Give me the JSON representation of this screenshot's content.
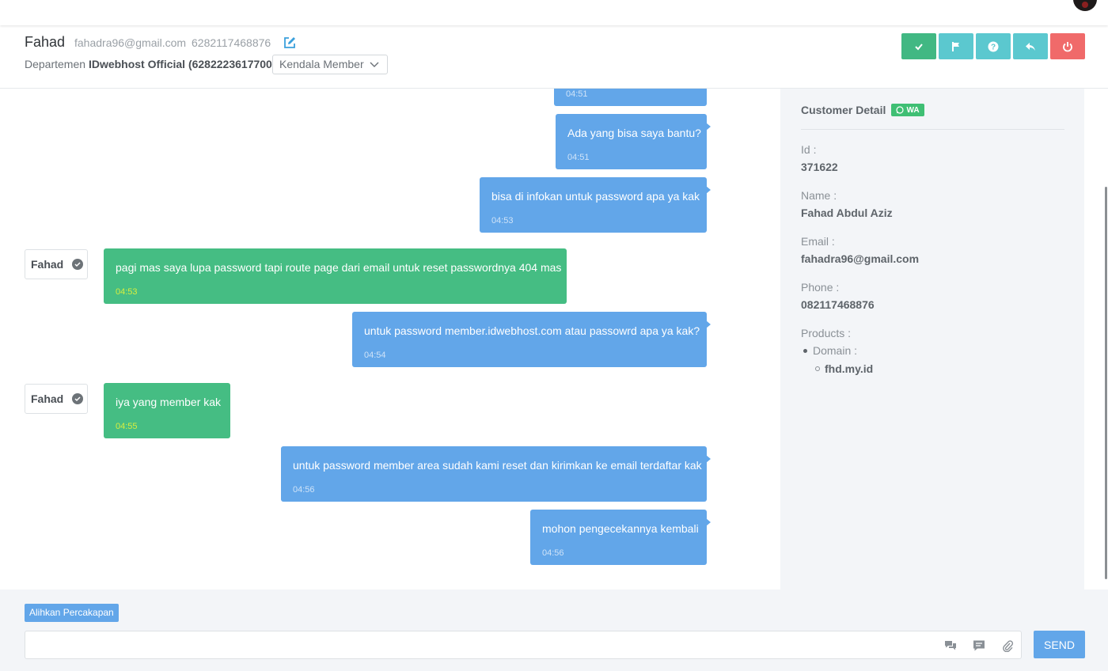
{
  "header": {
    "name": "Fahad",
    "email": "fahadra96@gmail.com",
    "phone": "6282117468876",
    "dept_prefix": "Departemen",
    "dept_name": "IDwebhost Official (6282223617700)",
    "category": "Kendala Member"
  },
  "messages": [
    {
      "from": "agent",
      "text": "",
      "time": "04:51"
    },
    {
      "from": "agent",
      "text": "Ada yang bisa saya bantu?",
      "time": "04:51"
    },
    {
      "from": "agent",
      "text": "bisa di infokan untuk password apa ya kak",
      "time": "04:53"
    },
    {
      "from": "customer",
      "sender": "Fahad",
      "text": "pagi mas saya lupa password tapi route page dari email untuk reset passwordnya 404 mas",
      "time": "04:53"
    },
    {
      "from": "agent",
      "text": "untuk password member.idwebhost.com atau passowrd apa ya kak?",
      "time": "04:54"
    },
    {
      "from": "customer",
      "sender": "Fahad",
      "text": "iya yang member kak",
      "time": "04:55"
    },
    {
      "from": "agent",
      "text": "untuk password member area sudah kami reset dan kirimkan ke email terdaftar kak",
      "time": "04:56"
    },
    {
      "from": "agent",
      "text": "mohon pengecekannya kembali",
      "time": "04:56"
    }
  ],
  "customer_detail": {
    "title": "Customer Detail",
    "badge": "WA",
    "id_label": "Id :",
    "id": "371622",
    "name_label": "Name :",
    "name": "Fahad Abdul Aziz",
    "email_label": "Email :",
    "email": "fahadra96@gmail.com",
    "phone_label": "Phone :",
    "phone": "082117468876",
    "products_label": "Products :",
    "product_type": "Domain :",
    "product_domain": "fhd.my.id"
  },
  "footer": {
    "transfer_label": "Alihkan Percakapan",
    "input_value": "",
    "send_label": "SEND"
  },
  "colors": {
    "agent_bubble": "#62a6e9",
    "customer_bubble": "#45bd83",
    "resolve": "#41b883",
    "action": "#5bc8cf",
    "close": "#f06a6a"
  }
}
